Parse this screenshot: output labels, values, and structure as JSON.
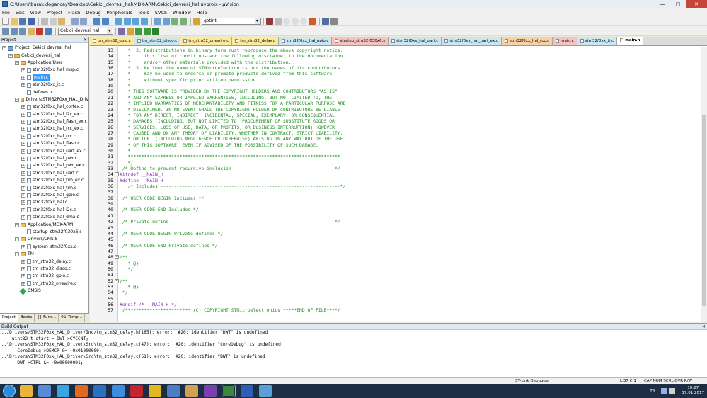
{
  "window": {
    "title": "C:\\Users\\burak.dogancay\\Desktop\\Cekici_devresi_hal\\MDK-ARM\\Cekici_devresi_hal.uvprojx - µVision",
    "minimize": "—",
    "maximize": "□",
    "close": "✕"
  },
  "menu": [
    "File",
    "Edit",
    "View",
    "Project",
    "Flash",
    "Debug",
    "Peripherals",
    "Tools",
    "SVCS",
    "Window",
    "Help"
  ],
  "toolbar": {
    "find_value": "getint",
    "target_value": "Cekici_devresi_hal"
  },
  "project_panel": {
    "title": "Project",
    "close": "✕",
    "tree": [
      {
        "label": "Project: Cekici_devresi_hal",
        "indent": 0,
        "kind": "proj",
        "toggle": "−"
      },
      {
        "label": "Cekici_devresi_hal",
        "indent": 1,
        "kind": "fold",
        "toggle": "−"
      },
      {
        "label": "Application/User",
        "indent": 2,
        "kind": "fold",
        "toggle": "−"
      },
      {
        "label": "stm32f0xx_hal_msp.c",
        "indent": 3,
        "kind": "file",
        "toggle": "+"
      },
      {
        "label": "main.c",
        "indent": 3,
        "kind": "file",
        "toggle": "+",
        "selected": true
      },
      {
        "label": "stm32f0xx_it.c",
        "indent": 3,
        "kind": "file",
        "toggle": "+"
      },
      {
        "label": "defines.h",
        "indent": 3,
        "kind": "file",
        "toggle": ""
      },
      {
        "label": "Drivers/STM32F0xx_HAL_Driv",
        "indent": 2,
        "kind": "fold",
        "toggle": "−"
      },
      {
        "label": "stm32f0xx_hal_cortex.c",
        "indent": 3,
        "kind": "file",
        "toggle": "+"
      },
      {
        "label": "stm32f0xx_hal_i2c_ex.c",
        "indent": 3,
        "kind": "file",
        "toggle": "+"
      },
      {
        "label": "stm32f0xx_hal_flash_ex.c",
        "indent": 3,
        "kind": "file",
        "toggle": "+"
      },
      {
        "label": "stm32f0xx_hal_rcc_ex.c",
        "indent": 3,
        "kind": "file",
        "toggle": "+"
      },
      {
        "label": "stm32f0xx_hal_rcc.c",
        "indent": 3,
        "kind": "file",
        "toggle": "+"
      },
      {
        "label": "stm32f0xx_hal_flash.c",
        "indent": 3,
        "kind": "file",
        "toggle": "+"
      },
      {
        "label": "stm32f0xx_hal_uart_ex.c",
        "indent": 3,
        "kind": "file",
        "toggle": "+"
      },
      {
        "label": "stm32f0xx_hal_pwr.c",
        "indent": 3,
        "kind": "file",
        "toggle": "+"
      },
      {
        "label": "stm32f0xx_hal_pwr_ex.c",
        "indent": 3,
        "kind": "file",
        "toggle": "+"
      },
      {
        "label": "stm32f0xx_hal_uart.c",
        "indent": 3,
        "kind": "file",
        "toggle": "+"
      },
      {
        "label": "stm32f0xx_hal_tim_ex.c",
        "indent": 3,
        "kind": "file",
        "toggle": "+"
      },
      {
        "label": "stm32f0xx_hal_tim.c",
        "indent": 3,
        "kind": "file",
        "toggle": "+"
      },
      {
        "label": "stm32f0xx_hal_gpio.c",
        "indent": 3,
        "kind": "file",
        "toggle": "+"
      },
      {
        "label": "stm32f0xx_hal.c",
        "indent": 3,
        "kind": "file",
        "toggle": "+"
      },
      {
        "label": "stm32f0xx_hal_i2c.c",
        "indent": 3,
        "kind": "file",
        "toggle": "+"
      },
      {
        "label": "stm32f0xx_hal_dma.c",
        "indent": 3,
        "kind": "file",
        "toggle": "+"
      },
      {
        "label": "Application/MDK-ARM",
        "indent": 2,
        "kind": "fold",
        "toggle": "−"
      },
      {
        "label": "startup_stm32f030x6.s",
        "indent": 3,
        "kind": "file",
        "toggle": ""
      },
      {
        "label": "Drivers/CMSIS",
        "indent": 2,
        "kind": "fold",
        "toggle": "−"
      },
      {
        "label": "system_stm32f0xx.c",
        "indent": 3,
        "kind": "file",
        "toggle": "+"
      },
      {
        "label": "TM",
        "indent": 2,
        "kind": "fold",
        "toggle": "−"
      },
      {
        "label": "tm_stm32_delay.c",
        "indent": 3,
        "kind": "file",
        "toggle": "+"
      },
      {
        "label": "tm_stm32_disco.c",
        "indent": 3,
        "kind": "file",
        "toggle": "+"
      },
      {
        "label": "tm_stm32_gpio.c",
        "indent": 3,
        "kind": "file",
        "toggle": "+"
      },
      {
        "label": "tm_stm32_onewire.c",
        "indent": 3,
        "kind": "file",
        "toggle": "+"
      },
      {
        "label": "CMSIS",
        "indent": 2,
        "kind": "gem",
        "toggle": ""
      }
    ],
    "bottom_tabs": [
      "Project",
      "Books",
      "{} Func...",
      "0↓ Temp..."
    ]
  },
  "editor_tabs": [
    {
      "label": "tm_stm32_gpio.c",
      "color": "#fde99a"
    },
    {
      "label": "tm_stm32_disco.c",
      "color": "#c9e6f2"
    },
    {
      "label": "tm_stm32_onewire.c",
      "color": "#fde99a"
    },
    {
      "label": "tm_stm32_delay.c",
      "color": "#fde99a"
    },
    {
      "label": "stm32f0xx_hal_gpio.c",
      "color": "#c9e6f2"
    },
    {
      "label": "startup_stm32f030x6.s",
      "color": "#f5c2c2"
    },
    {
      "label": "stm32f0xx_hal_uart.c",
      "color": "#c9e6f2"
    },
    {
      "label": "stm32f0xx_hal_uart_ex.c",
      "color": "#c9e6f2"
    },
    {
      "label": "stm32f0xx_hal_rcc.c",
      "color": "#f8d0a8"
    },
    {
      "label": "main.c",
      "color": "#f5c2c2"
    },
    {
      "label": "stm32f0xx_it.c",
      "color": "#c9e6f2"
    },
    {
      "label": "main.h",
      "color": "#ffffff",
      "active": true
    }
  ],
  "code_lines": [
    {
      "n": "13",
      "fold": "",
      "cls": "c-com",
      "text": "   *  2. Redistributions in binary form must reproduce the above copyright notice,"
    },
    {
      "n": "14",
      "fold": "",
      "cls": "c-com",
      "text": "   *     this list of conditions and the following disclaimer in the documentation"
    },
    {
      "n": "15",
      "fold": "",
      "cls": "c-com",
      "text": "   *     and/or other materials provided with the distribution."
    },
    {
      "n": "16",
      "fold": "",
      "cls": "c-com",
      "text": "   *  3. Neither the name of STMicroelectronics nor the names of its contributors"
    },
    {
      "n": "17",
      "fold": "",
      "cls": "c-com",
      "text": "   *     may be used to endorse or promote products derived from this software"
    },
    {
      "n": "18",
      "fold": "",
      "cls": "c-com",
      "text": "   *     without specific prior written permission."
    },
    {
      "n": "19",
      "fold": "",
      "cls": "c-com",
      "text": "   *"
    },
    {
      "n": "20",
      "fold": "",
      "cls": "c-com",
      "text": "   * THIS SOFTWARE IS PROVIDED BY THE COPYRIGHT HOLDERS AND CONTRIBUTORS \"AS IS\""
    },
    {
      "n": "21",
      "fold": "",
      "cls": "c-com",
      "text": "   * AND ANY EXPRESS OR IMPLIED WARRANTIES, INCLUDING, BUT NOT LIMITED TO, THE"
    },
    {
      "n": "22",
      "fold": "",
      "cls": "c-com",
      "text": "   * IMPLIED WARRANTIES OF MERCHANTABILITY AND FITNESS FOR A PARTICULAR PURPOSE ARE"
    },
    {
      "n": "23",
      "fold": "",
      "cls": "c-com",
      "text": "   * DISCLAIMED. IN NO EVENT SHALL THE COPYRIGHT HOLDER OR CONTRIBUTORS BE LIABLE"
    },
    {
      "n": "24",
      "fold": "",
      "cls": "c-com",
      "text": "   * FOR ANY DIRECT, INDIRECT, INCIDENTAL, SPECIAL, EXEMPLARY, OR CONSEQUENTIAL"
    },
    {
      "n": "25",
      "fold": "",
      "cls": "c-com",
      "text": "   * DAMAGES (INCLUDING, BUT NOT LIMITED TO, PROCUREMENT OF SUBSTITUTE GOODS OR"
    },
    {
      "n": "26",
      "fold": "",
      "cls": "c-com",
      "text": "   * SERVICES; LOSS OF USE, DATA, OR PROFITS; OR BUSINESS INTERRUPTION) HOWEVER"
    },
    {
      "n": "27",
      "fold": "",
      "cls": "c-com",
      "text": "   * CAUSED AND ON ANY THEORY OF LIABILITY, WHETHER IN CONTRACT, STRICT LIABILITY,"
    },
    {
      "n": "28",
      "fold": "",
      "cls": "c-com",
      "text": "   * OR TORT (INCLUDING NEGLIGENCE OR OTHERWISE) ARISING IN ANY WAY OUT OF THE USE"
    },
    {
      "n": "29",
      "fold": "",
      "cls": "c-com",
      "text": "   * OF THIS SOFTWARE, EVEN IF ADVISED OF THE POSSIBILITY OF SUCH DAMAGE."
    },
    {
      "n": "30",
      "fold": "",
      "cls": "c-com",
      "text": "   *"
    },
    {
      "n": "31",
      "fold": "",
      "cls": "c-com",
      "text": "   ******************************************************************************"
    },
    {
      "n": "32",
      "fold": "",
      "cls": "c-com",
      "text": "   */"
    },
    {
      "n": "33",
      "fold": "",
      "cls": "c-com",
      "text": " /* Define to prevent recursive inclusion -------------------------------------*/"
    },
    {
      "n": "34",
      "fold": "−",
      "cls": "c-pp",
      "text": "#ifndef __MAIN_H"
    },
    {
      "n": "35",
      "fold": "",
      "cls": "c-pp",
      "text": "#define __MAIN_H"
    },
    {
      "n": "36",
      "fold": "",
      "cls": "c-com",
      "text": "   /* Includes ------------------------------------------------------------------*/"
    },
    {
      "n": "37",
      "fold": "",
      "cls": "c-norm",
      "text": ""
    },
    {
      "n": "38",
      "fold": "",
      "cls": "c-com",
      "text": " /* USER CODE BEGIN Includes */"
    },
    {
      "n": "39",
      "fold": "",
      "cls": "c-norm",
      "text": ""
    },
    {
      "n": "40",
      "fold": "",
      "cls": "c-com",
      "text": " /* USER CODE END Includes */"
    },
    {
      "n": "41",
      "fold": "",
      "cls": "c-norm",
      "text": ""
    },
    {
      "n": "42",
      "fold": "",
      "cls": "c-com",
      "text": " /* Private define ------------------------------------------------------------*/"
    },
    {
      "n": "43",
      "fold": "",
      "cls": "c-norm",
      "text": ""
    },
    {
      "n": "44",
      "fold": "",
      "cls": "c-com",
      "text": " /* USER CODE BEGIN Private defines */"
    },
    {
      "n": "45",
      "fold": "",
      "cls": "c-norm",
      "text": ""
    },
    {
      "n": "46",
      "fold": "",
      "cls": "c-com",
      "text": " /* USER CODE END Private defines */"
    },
    {
      "n": "47",
      "fold": "",
      "cls": "c-norm",
      "text": ""
    },
    {
      "n": "48",
      "fold": "−",
      "cls": "c-com",
      "text": "/**"
    },
    {
      "n": "49",
      "fold": "",
      "cls": "c-com",
      "text": "   * @}"
    },
    {
      "n": "50",
      "fold": "",
      "cls": "c-com",
      "text": "   */"
    },
    {
      "n": "51",
      "fold": "",
      "cls": "c-norm",
      "text": ""
    },
    {
      "n": "52",
      "fold": "−",
      "cls": "c-com",
      "text": "/**"
    },
    {
      "n": "53",
      "fold": "",
      "cls": "c-com",
      "text": "   * @}"
    },
    {
      "n": "54",
      "fold": "",
      "cls": "c-com",
      "text": " */"
    },
    {
      "n": "55",
      "fold": "",
      "cls": "c-norm",
      "text": ""
    },
    {
      "n": "56",
      "fold": "",
      "cls": "c-pp",
      "text": "#endif /* __MAIN_H */"
    },
    {
      "n": "57",
      "fold": "",
      "cls": "c-com",
      "text": " /************************ (C) COPYRIGHT STMicroelectronics *****END OF FILE****/"
    }
  ],
  "build_output": {
    "title": "Build Output",
    "close": "✕",
    "lines": [
      "../Drivers/STM32F0xx_HAL_Driver/Inc/tm_stm32_delay.h(185): error:  #20: identifier \"DWT\" is undefined",
      "    uint32_t start = DWT->CYCCNT;",
      "..\\Drivers\\STM32F0xx_HAL_Driver\\Src\\tm_stm32_delay.c(47): error:  #20: identifier \"CoreDebug\" is undefined",
      "      CoreDebug->DEMCR &= ~0x01000000;",
      "..\\Drivers\\STM32F0xx_HAL_Driver\\Src\\tm_stm32_delay.c(51): error:  #20: identifier \"DWT\" is undefined",
      "      DWT->CTRL &= ~0x00000001;"
    ]
  },
  "status": {
    "debugger": "ST-Link Debugger",
    "position": "L:37 C:1",
    "indicators": "CAP  NUM  SCRL  OVR  R/W"
  },
  "taskbar": {
    "apps": [
      {
        "icon": "explorer-icon",
        "color": "#e8b53a"
      },
      {
        "icon": "media-icon",
        "color": "#5a8ad6"
      },
      {
        "icon": "messenger-icon",
        "color": "#3aa6e0"
      },
      {
        "icon": "office-icon",
        "color": "#e06a1f"
      },
      {
        "icon": "outlook-icon",
        "color": "#2b6fc1"
      },
      {
        "icon": "onedrive-icon",
        "color": "#3c8ce0"
      },
      {
        "icon": "filezilla-icon",
        "color": "#c0272d"
      },
      {
        "icon": "chrome-icon",
        "color": "#e6b820"
      },
      {
        "icon": "network-icon",
        "color": "#4c7cc4"
      },
      {
        "icon": "photos-icon",
        "color": "#d0a14e"
      },
      {
        "icon": "app-icon",
        "color": "#7c3fb0"
      },
      {
        "icon": "keil-icon",
        "color": "#3b8a3b",
        "active": true
      },
      {
        "icon": "word-icon",
        "color": "#2b5fb4"
      },
      {
        "icon": "monitor-icon",
        "color": "#5aa0d8"
      }
    ],
    "language": "TR",
    "time": "10:27",
    "date": "17.01.2017"
  },
  "colors": {
    "comment": "#218d21",
    "preprocessor": "#7f2db3",
    "selection": "#3399ff"
  }
}
